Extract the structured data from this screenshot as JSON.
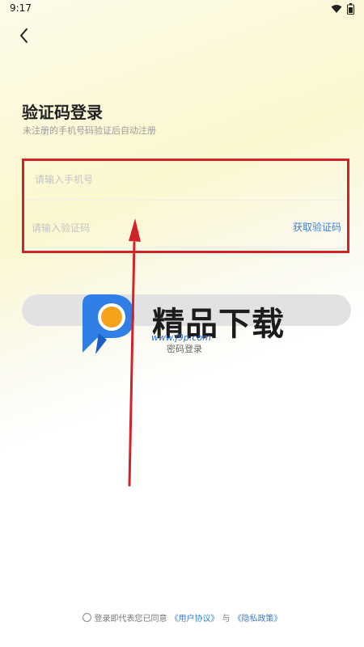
{
  "status_bar": {
    "time": "9:17"
  },
  "header": {
    "back_icon": "chevron-left-icon"
  },
  "page": {
    "title": "验证码登录",
    "subtitle": "未注册的手机号码验证后自动注册"
  },
  "form": {
    "phone_placeholder": "请输入手机号",
    "code_placeholder": "请输入验证码",
    "get_code_label": "获取验证码"
  },
  "actions": {
    "login_label": "",
    "password_login_label": "密码登录"
  },
  "watermark": {
    "text": "精品下载",
    "url": "www.j9p.com"
  },
  "agreement": {
    "prefix": "登录即代表您已同意",
    "user_agreement": "《用户协议》",
    "and": "与",
    "privacy_policy": "《隐私政策》"
  },
  "colors": {
    "accent": "#3a7fd8",
    "annotation": "#d2232a",
    "button_bg": "#e2e2e2"
  }
}
